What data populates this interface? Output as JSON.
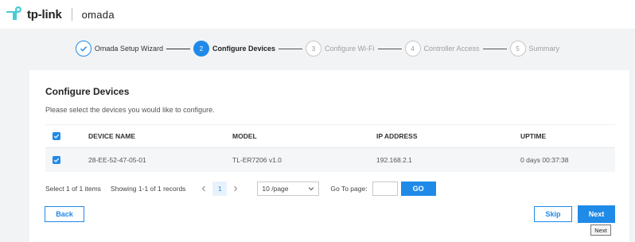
{
  "header": {
    "brand": "tp-link",
    "product": "omada"
  },
  "wizard": {
    "steps": [
      {
        "number": "",
        "label": "Omada Setup Wizard",
        "state": "done"
      },
      {
        "number": "2",
        "label": "Configure Devices",
        "state": "active"
      },
      {
        "number": "3",
        "label": "Configure Wi-Fi",
        "state": "pending"
      },
      {
        "number": "4",
        "label": "Controller Access",
        "state": "pending"
      },
      {
        "number": "5",
        "label": "Summary",
        "state": "pending"
      }
    ]
  },
  "page": {
    "title": "Configure Devices",
    "description": "Please select the devices you would like to configure."
  },
  "table": {
    "columns": [
      "DEVICE NAME",
      "MODEL",
      "IP ADDRESS",
      "UPTIME"
    ],
    "rows": [
      {
        "selected": true,
        "device_name": "28-EE-52-47-05-01",
        "model": "TL-ER7206 v1.0",
        "ip": "192.168.2.1",
        "uptime": "0 days 00:37:38"
      }
    ]
  },
  "pager": {
    "selected_text": "Select 1 of 1 items",
    "showing_text": "Showing 1-1 of 1 records",
    "current_page": "1",
    "page_size": "10 /page",
    "goto_label": "Go To page:",
    "goto_value": "",
    "go_label": "GO"
  },
  "actions": {
    "back": "Back",
    "skip": "Skip",
    "next": "Next"
  },
  "tooltip": "Next",
  "colors": {
    "accent": "#1f8ae8",
    "background": "#f2f3f5"
  }
}
